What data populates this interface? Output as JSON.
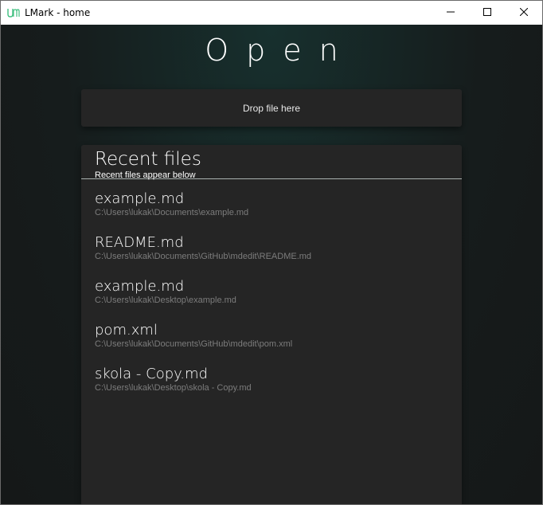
{
  "window": {
    "title": "LMark - home"
  },
  "page": {
    "heading": "Open"
  },
  "dropzone": {
    "label": "Drop file here"
  },
  "recent": {
    "title": "Recent files",
    "subtitle": "Recent files appear below",
    "items": [
      {
        "name": "example.md",
        "path": "C:\\Users\\lukak\\Documents\\example.md"
      },
      {
        "name": "README.md",
        "path": "C:\\Users\\lukak\\Documents\\GitHub\\mdedit\\README.md"
      },
      {
        "name": "example.md",
        "path": "C:\\Users\\lukak\\Desktop\\example.md"
      },
      {
        "name": "pom.xml",
        "path": "C:\\Users\\lukak\\Documents\\GitHub\\mdedit\\pom.xml"
      },
      {
        "name": "skola - Copy.md",
        "path": "C:\\Users\\lukak\\Desktop\\skola - Copy.md"
      }
    ]
  },
  "colors": {
    "background": "#1c2322",
    "panel": "#252525",
    "path_text": "#7c7c7c",
    "app_icon": "#3fbf7f"
  },
  "icons": {
    "app": "lmark-app-icon",
    "minimize": "minimize-icon",
    "maximize": "maximize-icon",
    "close": "close-icon"
  }
}
